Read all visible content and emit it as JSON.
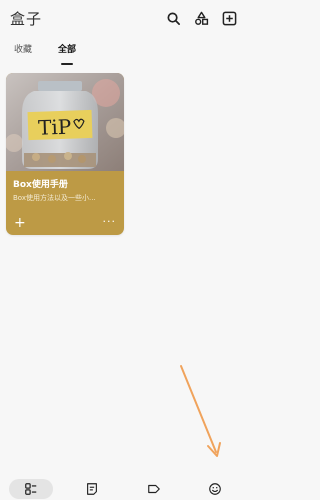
{
  "header": {
    "title": "盒子",
    "icons": [
      "search-icon",
      "tag-shapes-icon",
      "add-box-icon"
    ]
  },
  "tabs": [
    {
      "label": "收藏",
      "active": false
    },
    {
      "label": "全部",
      "active": true
    }
  ],
  "card": {
    "image_text": "TiP",
    "title": "Box使用手册",
    "description": "Box使用方法以及一些小...",
    "add_label": "+",
    "more_label": "···"
  },
  "bottom_nav": [
    {
      "name": "boxes",
      "icon": "grid-icon",
      "active": true
    },
    {
      "name": "notes",
      "icon": "note-icon",
      "active": false
    },
    {
      "name": "tags",
      "icon": "tag-icon",
      "active": false
    },
    {
      "name": "profile",
      "icon": "smiley-icon",
      "active": false
    }
  ],
  "colors": {
    "card_background": "#bd9a45",
    "annotation_arrow": "#f0a35c",
    "page_background": "#f7f7f7"
  }
}
